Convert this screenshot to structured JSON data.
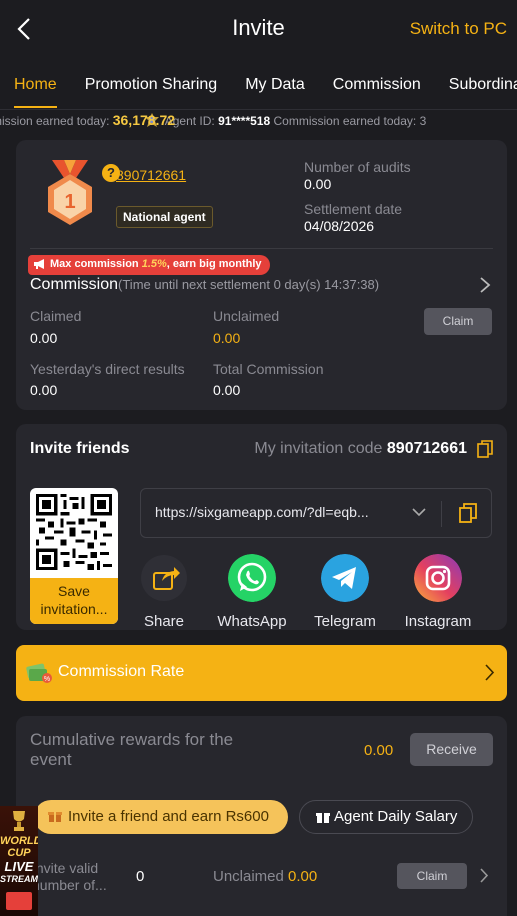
{
  "header": {
    "title": "Invite",
    "switch_label": "Switch to PC"
  },
  "tabs": [
    "Home",
    "Promotion Sharing",
    "My Data",
    "Commission",
    "Subordinate"
  ],
  "marquee": {
    "label1": "mission earned today: ",
    "value1": "36,178.72",
    "agent_label": "Agent ID: ",
    "agent_value": "91****518",
    "label2": " Commission earned today: 3"
  },
  "agent": {
    "id": "890712661",
    "level": "1",
    "tag": "National agent",
    "audits_label": "Number of audits",
    "audits_value": "0.00",
    "settlement_label": "Settlement date",
    "settlement_value": "04/08/2026"
  },
  "commission": {
    "promo_prefix": "Max commission ",
    "promo_pct": "1.5%",
    "promo_suffix": ", earn big monthly",
    "title": "Commission",
    "subtitle": "(Time until next settlement  0 day(s) 14:37:38)",
    "claimed_label": "Claimed",
    "claimed_value": "0.00",
    "unclaimed_label": "Unclaimed",
    "unclaimed_value": "0.00",
    "claim_button": "Claim",
    "yesterday_label": "Yesterday's direct results",
    "yesterday_value": "0.00",
    "total_label": "Total Commission",
    "total_value": "0.00"
  },
  "invite": {
    "title": "Invite friends",
    "code_label": "My invitation code ",
    "code_value": "890712661",
    "save_label": "Save invitation...",
    "link": "https://sixgameapp.com/?dl=eqb...",
    "share_items": [
      "Share",
      "WhatsApp",
      "Telegram",
      "Instagram"
    ]
  },
  "commission_rate": {
    "label": "Commission Rate"
  },
  "event": {
    "cumulative_label": "Cumulative rewards for the event",
    "cumulative_value": "0.00",
    "receive_button": "Receive",
    "invite_pill": "Invite a friend and earn Rs600",
    "salary_pill": "Agent Daily Salary",
    "invite_valid_label": "Invite valid number of...",
    "invite_valid_value": "0",
    "unclaimed_label": "Unclaimed ",
    "unclaimed_value": "0.00",
    "claim_button": "Claim"
  },
  "promo_banner": {
    "line1": "WORLD",
    "line2": "CUP",
    "line3": "LIVE",
    "line4": "STREAM"
  },
  "colors": {
    "accent": "#f5b214",
    "background": "#1c1c20",
    "card": "#27272d",
    "promo_red": "#e5403a"
  },
  "icons": [
    "back-arrow-icon",
    "medal-icon",
    "question-icon",
    "megaphone-icon",
    "chevron-right-icon",
    "copy-icon",
    "qr-code",
    "chevron-down-icon",
    "share-icon",
    "whatsapp-icon",
    "telegram-icon",
    "instagram-icon",
    "money-icon",
    "gift-icon"
  ]
}
